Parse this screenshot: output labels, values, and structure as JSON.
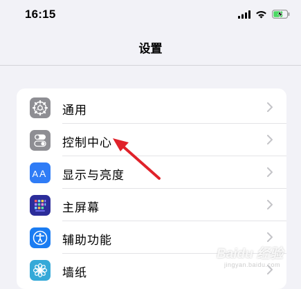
{
  "status_bar": {
    "time": "16:15",
    "signal_icon": "cellular-signal-icon",
    "wifi_icon": "wifi-icon",
    "battery_icon": "battery-charging-icon"
  },
  "nav": {
    "title": "设置"
  },
  "settings": {
    "items": [
      {
        "label": "通用",
        "icon": "gear-icon",
        "icon_color": "#8e8e93"
      },
      {
        "label": "控制中心",
        "icon": "control-center-toggle-icon",
        "icon_color": "#8e8e93"
      },
      {
        "label": "显示与亮度",
        "icon": "display-aa-icon",
        "icon_color": "#2f7cf6"
      },
      {
        "label": "主屏幕",
        "icon": "home-screen-grid-icon",
        "icon_color": "#3a3bc2"
      },
      {
        "label": "辅助功能",
        "icon": "accessibility-icon",
        "icon_color": "#1a7cf2"
      },
      {
        "label": "墙纸",
        "icon": "wallpaper-flower-icon",
        "icon_color": "#35a9d8"
      }
    ]
  },
  "annotation": {
    "arrow_color": "#e0222a"
  },
  "watermark": {
    "text": "Baidu 经验",
    "sub": "jingyan.baidu.com"
  }
}
